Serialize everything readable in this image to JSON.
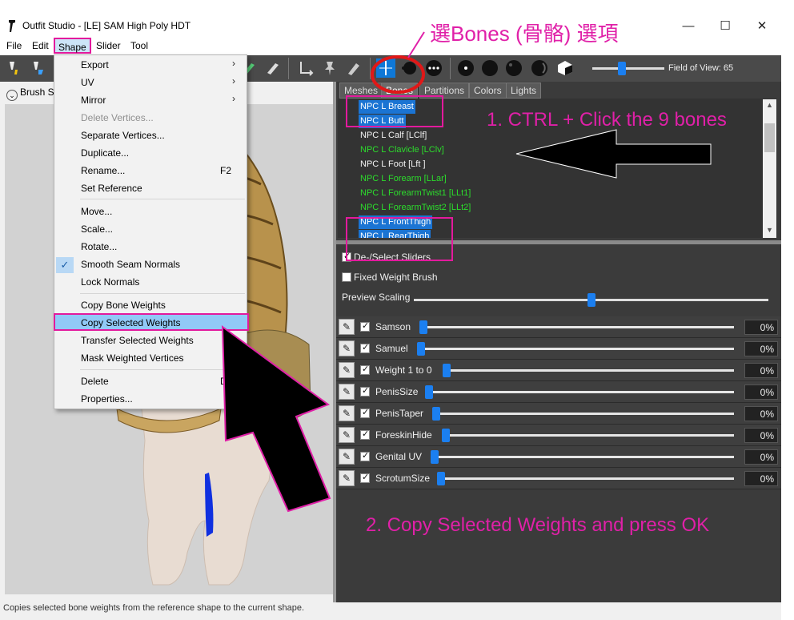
{
  "window": {
    "title": "Outfit Studio - [LE] SAM High Poly HDT",
    "minimize": "—",
    "maximize": "☐",
    "close": "✕"
  },
  "menubar": [
    "File",
    "Edit",
    "Shape",
    "Slider",
    "Tool"
  ],
  "shape_menu": {
    "items": [
      {
        "label": "Export",
        "arrow": "›"
      },
      {
        "label": "UV",
        "arrow": "›"
      },
      {
        "label": "Mirror",
        "arrow": "›"
      },
      {
        "label": "Delete Vertices...",
        "disabled": true
      },
      {
        "label": "Separate Vertices..."
      },
      {
        "label": "Duplicate..."
      },
      {
        "label": "Rename...",
        "shortcut": "F2"
      },
      {
        "label": "Set Reference"
      },
      {
        "label": "Move..."
      },
      {
        "label": "Scale..."
      },
      {
        "label": "Rotate..."
      },
      {
        "label": "Smooth Seam Normals",
        "checked": true
      },
      {
        "label": "Lock Normals"
      },
      {
        "label": "Copy Bone Weights"
      },
      {
        "label": "Copy Selected Weights",
        "highlighted": true
      },
      {
        "label": "Transfer Selected Weights"
      },
      {
        "label": "Mask Weighted Vertices"
      },
      {
        "label": "Delete",
        "shortcut": "D"
      },
      {
        "label": "Properties..."
      }
    ]
  },
  "toolbar": {
    "fov_label": "Field of View: 65"
  },
  "left_panel": {
    "brush_label": "Brush Se",
    "collapse_icon": "⌄"
  },
  "tabs": [
    "Meshes",
    "Bones",
    "Partitions",
    "Colors",
    "Lights"
  ],
  "bones": [
    {
      "name": "NPC L Breast",
      "state": "selected"
    },
    {
      "name": "NPC L Butt",
      "state": "selected"
    },
    {
      "name": "NPC L Calf [LClf]",
      "state": "white"
    },
    {
      "name": "NPC L Clavicle [LClv]",
      "state": "green"
    },
    {
      "name": "NPC L Foot [Lft ]",
      "state": "white"
    },
    {
      "name": "NPC L Forearm [LLar]",
      "state": "green"
    },
    {
      "name": "NPC L ForearmTwist1 [LLt1]",
      "state": "green"
    },
    {
      "name": "NPC L ForearmTwist2 [LLt2]",
      "state": "green"
    },
    {
      "name": "NPC L FrontThigh",
      "state": "selected"
    },
    {
      "name": "NPC L RearThigh",
      "state": "selected"
    }
  ],
  "options": {
    "deselect_sliders": "De-/Select Sliders",
    "fixed_weight_brush": "Fixed Weight Brush",
    "preview_scaling": "Preview Scaling",
    "preview_scaling_level": 0.5
  },
  "sliders": [
    {
      "name": "Samson",
      "value": "0%",
      "pen": "✎"
    },
    {
      "name": "Samuel",
      "value": "0%",
      "pen": "✎"
    },
    {
      "name": "Weight 1 to 0",
      "value": "0%",
      "pen": "✎"
    },
    {
      "name": "PenisSize",
      "value": "0%",
      "pen": "✎"
    },
    {
      "name": "PenisTaper",
      "value": "0%",
      "pen": "✎"
    },
    {
      "name": "ForeskinHide",
      "value": "0%",
      "pen": "✎"
    },
    {
      "name": "Genital UV",
      "value": "0%",
      "pen": "✎"
    },
    {
      "name": "ScrotumSize",
      "value": "0%",
      "pen": "✎"
    }
  ],
  "status_bar": "Copies selected bone weights from the reference shape to the current shape.",
  "annotations": {
    "top": "選Bones (骨骼) 選項",
    "step1": "1.  CTRL + Click the 9 bones",
    "step2": "2. Copy Selected Weights and press OK"
  },
  "colors": {
    "annotation": "#e020a8",
    "selection_blue": "#1b74d3",
    "green_bone": "#2cdc2c",
    "panel_dark": "#3b3b3b"
  }
}
